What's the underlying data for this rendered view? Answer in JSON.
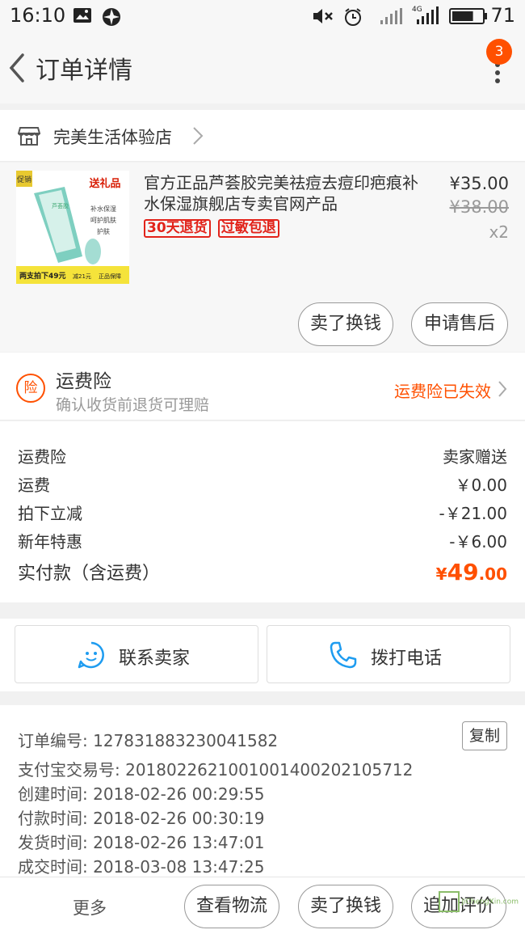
{
  "status_bar": {
    "time": "16:10",
    "battery_percent": "71",
    "network": "4G"
  },
  "nav": {
    "title": "订单详情",
    "badge_count": "3"
  },
  "shop": {
    "name": "完美生活体验店"
  },
  "product": {
    "name": "官方正品芦荟胶完美祛痘去痘印疤痕补水保湿旗舰店专卖官网产品",
    "tags": [
      "30天退货",
      "过敏包退"
    ],
    "price": "¥35.00",
    "original_price": "¥38.00",
    "quantity": "x2",
    "thumb": {
      "gift": "送礼品",
      "corner": "促销",
      "brand": "芦荟胶",
      "features": [
        "补水保湿",
        "呵护肌肤",
        "护肤"
      ],
      "promo": "两支拍下49元",
      "discount": "减21元",
      "guarantee": "正品保障"
    },
    "actions": [
      "卖了换钱",
      "申请售后"
    ]
  },
  "insurance": {
    "icon_text": "险",
    "title": "运费险",
    "subtitle": "确认收货前退货可理赔",
    "status": "运费险已失效"
  },
  "summary": {
    "rows": [
      {
        "label": "运费险",
        "value": "卖家赠送"
      },
      {
        "label": "运费",
        "value": "￥0.00"
      },
      {
        "label": "拍下立减",
        "value": "-￥21.00"
      },
      {
        "label": "新年特惠",
        "value": "-￥6.00"
      }
    ],
    "total_label": "实付款（含运费）",
    "total_currency": "¥",
    "total_int": "49",
    "total_dec": ".00"
  },
  "contact": {
    "seller_label": "联系卖家",
    "phone_label": "拨打电话"
  },
  "order_info": {
    "copy_label": "复制",
    "rows": [
      "订单编号: 127831883230041582",
      "支付宝交易号: 2018022621001001400202105712",
      "创建时间: 2018-02-26 00:29:55",
      "付款时间: 2018-02-26 00:30:19",
      "发货时间: 2018-02-26 13:47:01",
      "成交时间: 2018-03-08 13:47:25"
    ]
  },
  "bottom_bar": {
    "more_label": "更多",
    "actions": [
      "查看物流",
      "卖了换钱",
      "追加评价"
    ]
  },
  "watermark": {
    "text": "JiChengXin.com"
  },
  "colors": {
    "accent": "#ff5000",
    "tag_red": "#e2231a",
    "contact_blue": "#1e9cf0"
  }
}
